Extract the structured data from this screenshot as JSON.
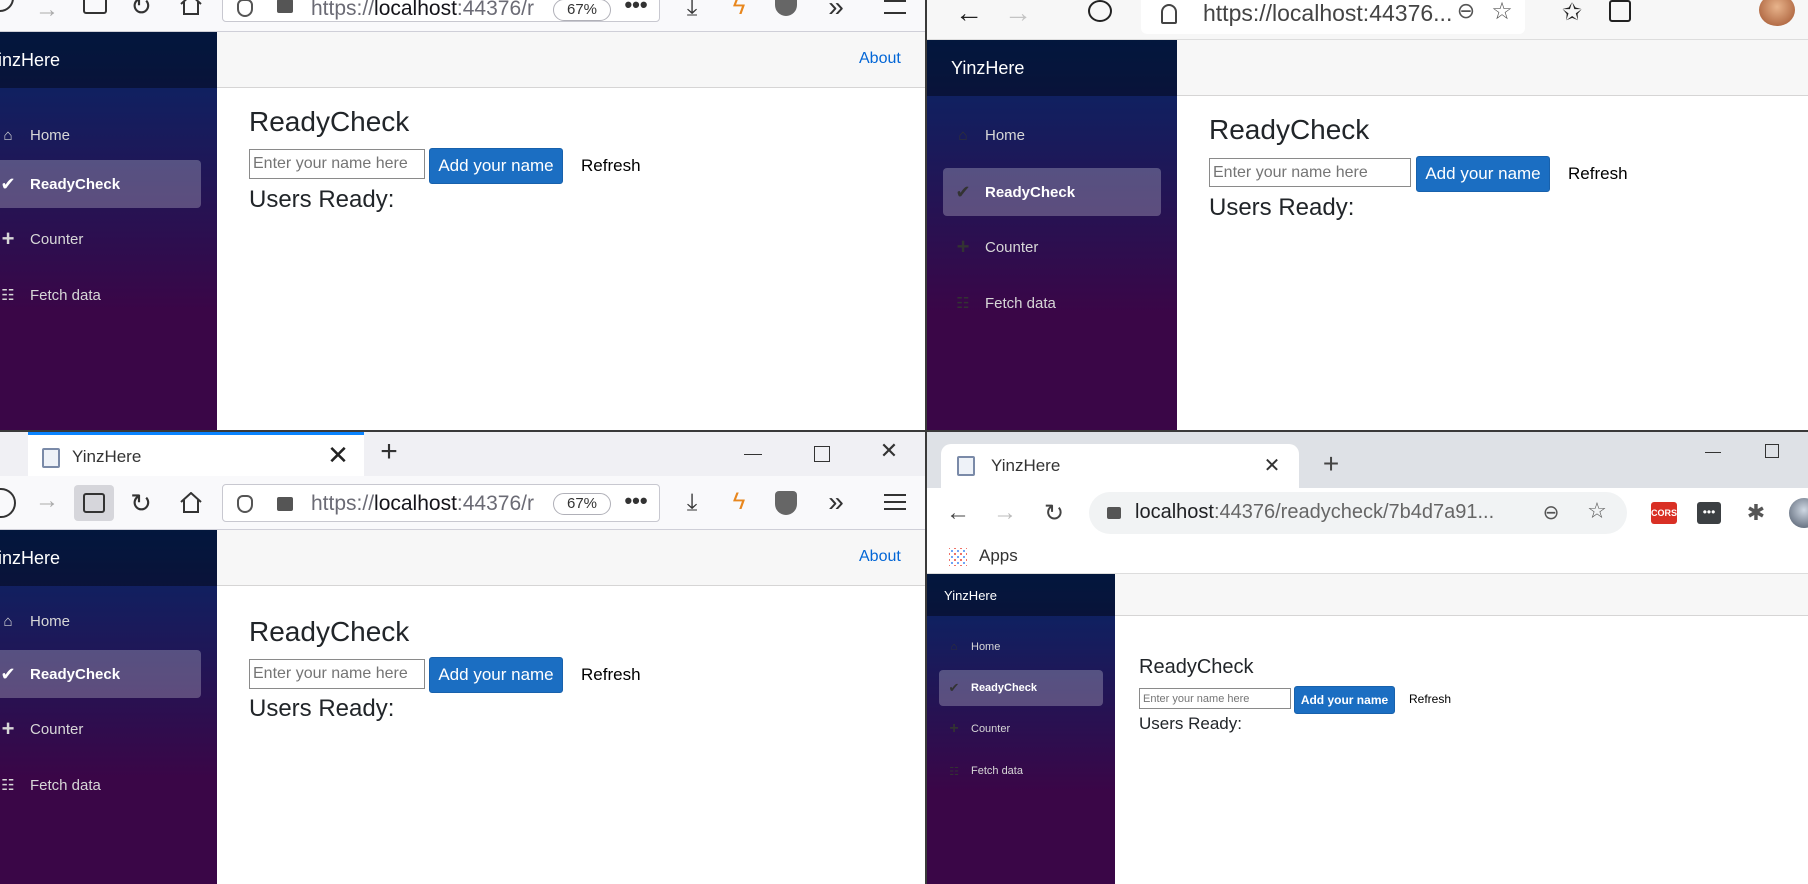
{
  "app": {
    "brand": "YinzHere",
    "brand_cut": "inzHere",
    "nav": {
      "home": "Home",
      "readycheck": "ReadyCheck",
      "counter": "Counter",
      "fetch": "Fetch data"
    },
    "about": "About",
    "page_title": "ReadyCheck",
    "name_placeholder": "Enter your name here",
    "add_button": "Add your name",
    "refresh": "Refresh",
    "users_ready": "Users Ready:"
  },
  "firefox": {
    "tab_title": "YinzHere",
    "url_prefix": "https://",
    "url_host": "localhost",
    "url_rest": ":44376/r",
    "zoom": "67%"
  },
  "edge": {
    "url": "https://localhost:44376..."
  },
  "chrome": {
    "tab_title": "YinzHere",
    "url_host": "localhost",
    "url_rest": ":44376/readycheck/7b4d7a91...",
    "bookmark_apps": "Apps",
    "cors_badge": "CORS"
  },
  "colors": {
    "accent": "#1b6ec2",
    "link": "#0366d6",
    "sidebar_top": "#052767",
    "sidebar_bottom": "#3a0647",
    "ff_tab_accent": "#0a84ff"
  }
}
